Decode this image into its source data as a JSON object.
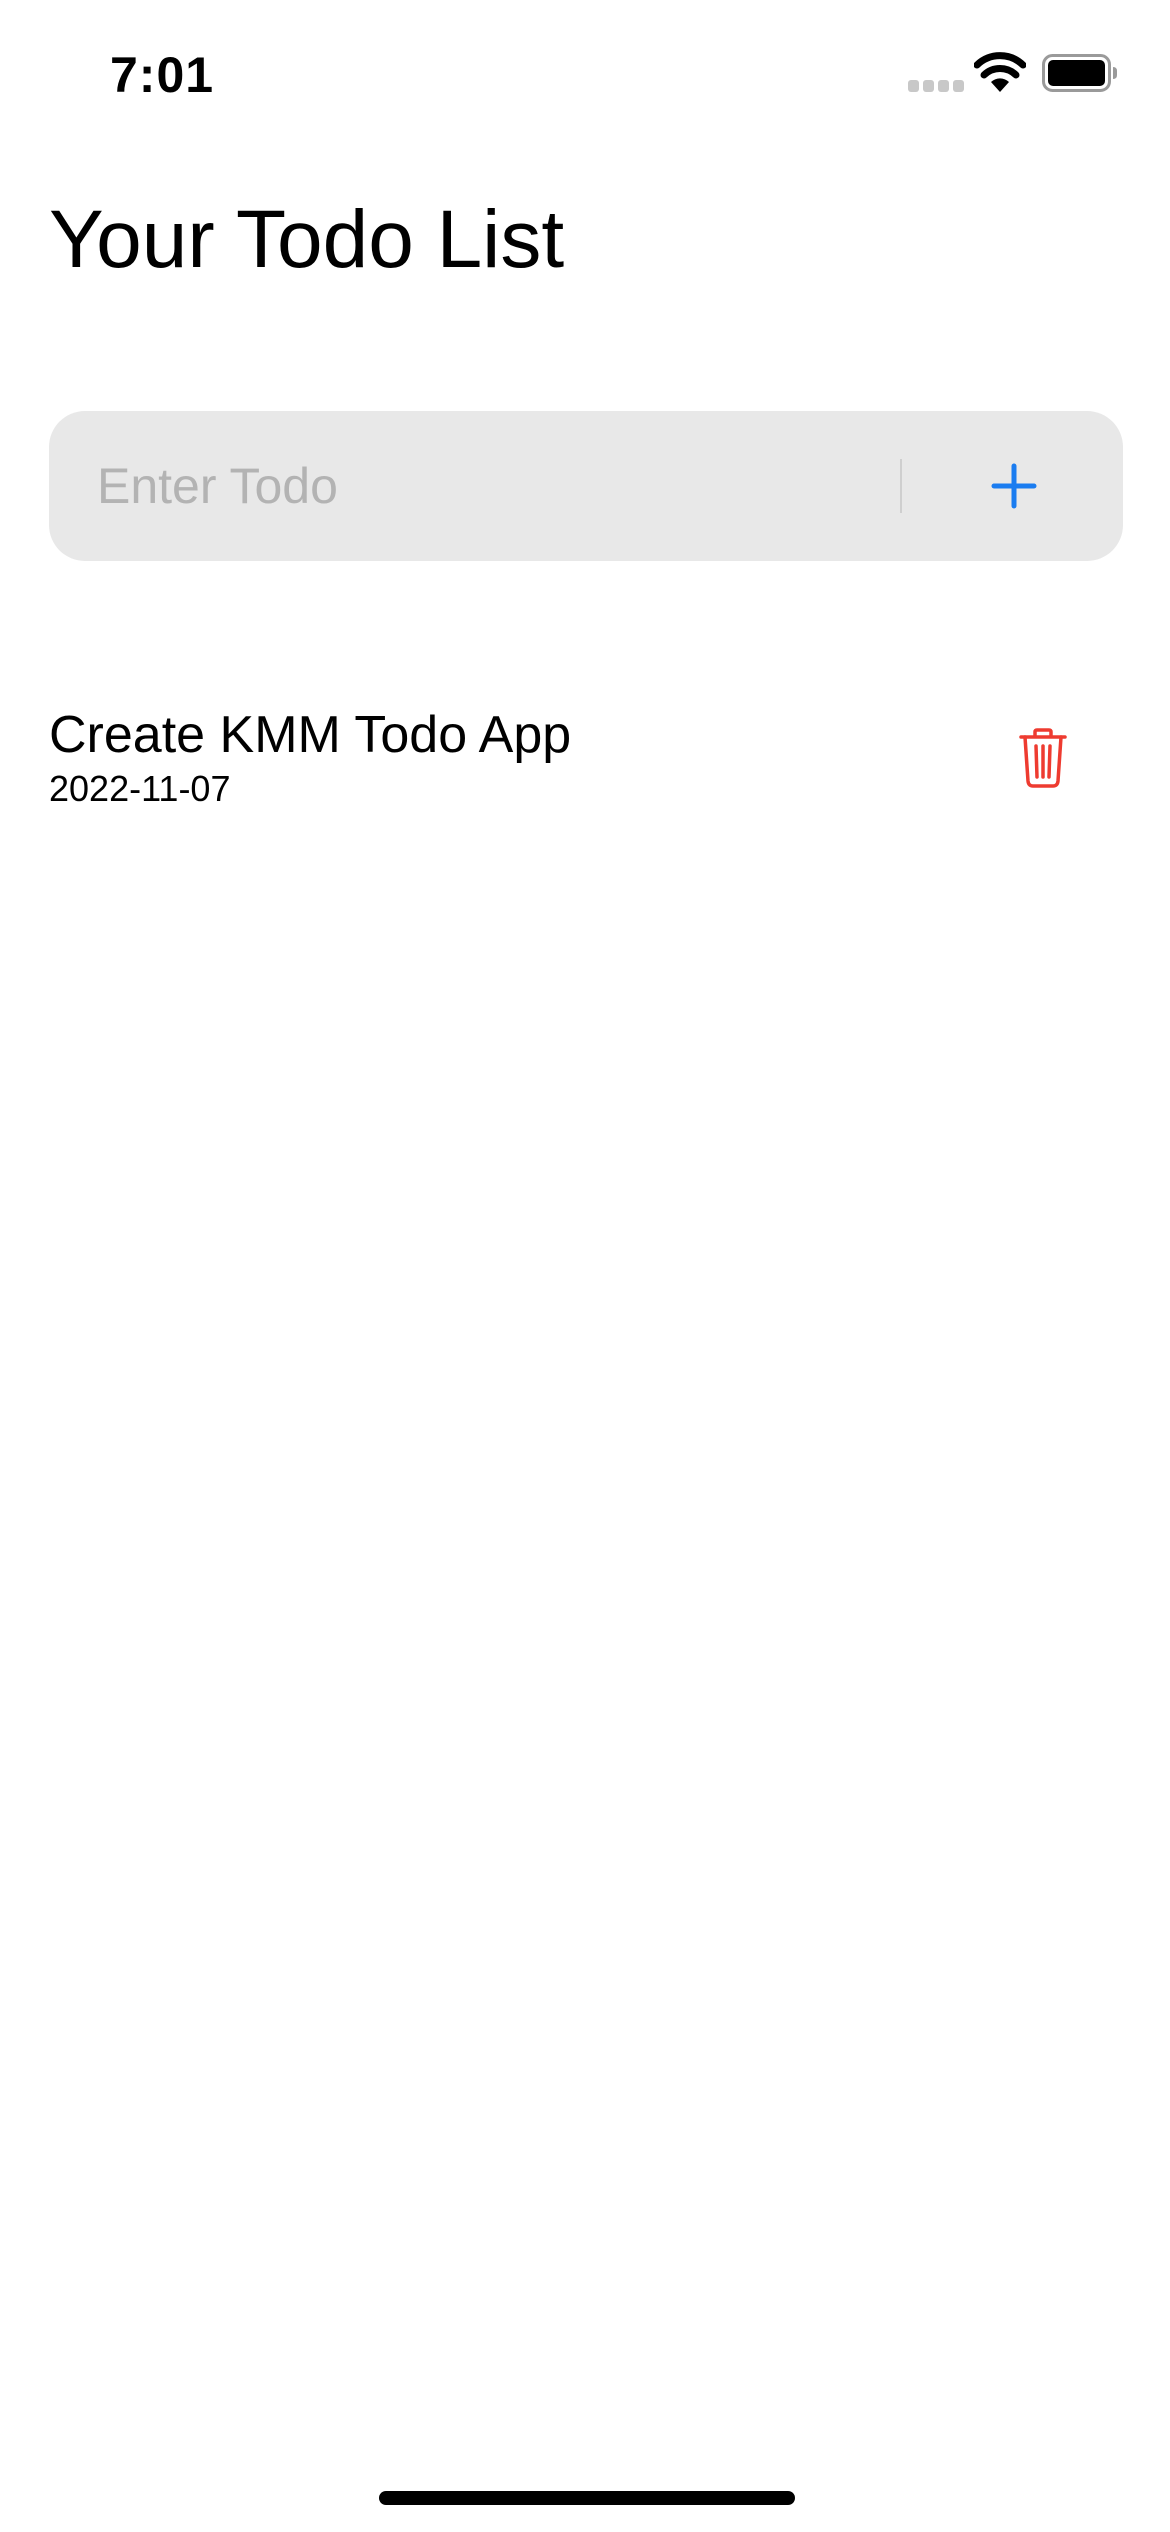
{
  "status_bar": {
    "time": "7:01",
    "icons": [
      "signal-icon",
      "wifi-icon",
      "battery-icon"
    ]
  },
  "page_title": "Your Todo List",
  "input": {
    "placeholder": "Enter Todo",
    "value": "",
    "add_icon": "plus-icon"
  },
  "todos": [
    {
      "title": "Create KMM Todo App",
      "date": "2022-11-07",
      "delete_icon": "trash-icon"
    }
  ],
  "colors": {
    "accent": "#1a7cf0",
    "destructive": "#ee3b30",
    "input_background": "#e8e8e8",
    "placeholder": "#b3b3b3"
  }
}
